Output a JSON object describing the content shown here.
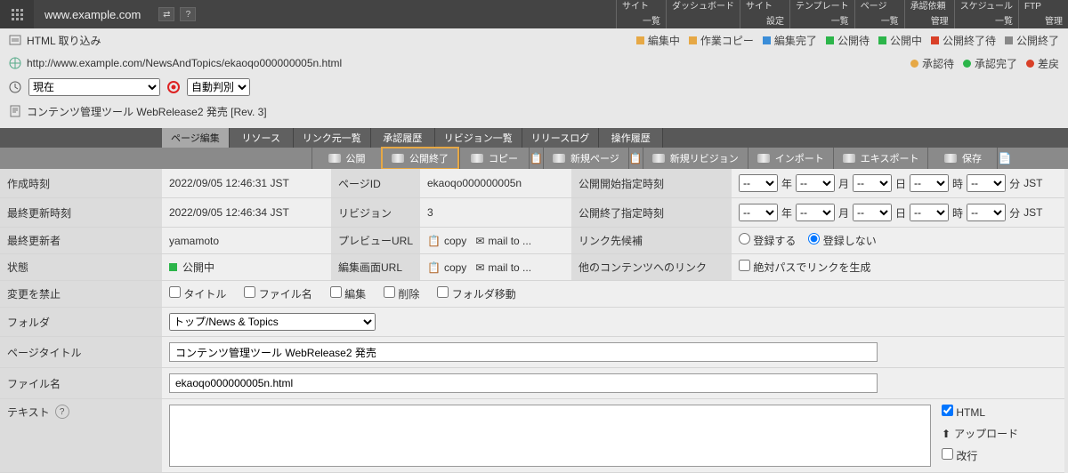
{
  "header": {
    "site_name": "www.example.com",
    "nav": [
      {
        "label": "サイト",
        "sub": "一覧"
      },
      {
        "label": "ダッシュボード",
        "sub": ""
      },
      {
        "label": "サイト",
        "sub": "設定"
      },
      {
        "label": "テンプレート",
        "sub": "一覧"
      },
      {
        "label": "ページ",
        "sub": "一覧"
      },
      {
        "label": "承認依頼",
        "sub": "管理"
      },
      {
        "label": "スケジュール",
        "sub": "一覧"
      },
      {
        "label": "FTP",
        "sub": "管理"
      }
    ]
  },
  "import_row": {
    "label": "HTML 取り込み",
    "status_legend": [
      {
        "label": "編集中",
        "color": "#e6a845",
        "shape": "sq"
      },
      {
        "label": "作業コピー",
        "color": "#e6a845",
        "shape": "sq"
      },
      {
        "label": "編集完了",
        "color": "#3a8dd8",
        "shape": "sq"
      },
      {
        "label": "公開待",
        "color": "#2cb54a",
        "shape": "sq"
      },
      {
        "label": "公開中",
        "color": "#2cb54a",
        "shape": "sq"
      },
      {
        "label": "公開終了待",
        "color": "#d94028",
        "shape": "sq"
      },
      {
        "label": "公開終了",
        "color": "#888",
        "shape": "sq"
      }
    ]
  },
  "url_row": {
    "url": "http://www.example.com/NewsAndTopics/ekaoqo000000005n.html",
    "approval_legend": [
      {
        "label": "承認待",
        "color": "#e6a845",
        "shape": "circ"
      },
      {
        "label": "承認完了",
        "color": "#2cb54a",
        "shape": "circ"
      },
      {
        "label": "差戻",
        "color": "#d94028",
        "shape": "circ"
      }
    ]
  },
  "history_row": {
    "time_select_value": "現在",
    "encoding_select_value": "自動判別"
  },
  "title_row": {
    "page_title_display": "コンテンツ管理ツール WebRelease2 発売 [Rev. 3]"
  },
  "tabs": [
    "ページ編集",
    "リソース",
    "リンク元一覧",
    "承認履歴",
    "リビジョン一覧",
    "リリースログ",
    "操作履歴"
  ],
  "active_tab": "ページ編集",
  "toolbar": {
    "publish": "公開",
    "unpublish": "公開終了",
    "copy": "コピー",
    "new_page": "新規ページ",
    "new_revision": "新規リビジョン",
    "import": "インポート",
    "export": "エキスポート",
    "save": "保存"
  },
  "details": {
    "created_label": "作成時刻",
    "created_value": "2022/09/05 12:46:31 JST",
    "updated_label": "最終更新時刻",
    "updated_value": "2022/09/05 12:46:34 JST",
    "updater_label": "最終更新者",
    "updater_value": "yamamoto",
    "state_label": "状態",
    "state_value": "公開中",
    "page_id_label": "ページID",
    "page_id_value": "ekaoqo000000005n",
    "revision_label": "リビジョン",
    "revision_value": "3",
    "preview_url_label": "プレビューURL",
    "edit_url_label": "編集画面URL",
    "copy_action": "copy",
    "mailto_action": "mail to ...",
    "pub_start_label": "公開開始指定時刻",
    "pub_end_label": "公開終了指定時刻",
    "date_units": {
      "year": "年",
      "month": "月",
      "day": "日",
      "hour": "時",
      "minute": "分",
      "tz": "JST",
      "dash": "--"
    },
    "link_candidate_label": "リンク先候補",
    "link_candidate_yes": "登録する",
    "link_candidate_no": "登録しない",
    "other_link_label": "他のコンテンツへのリンク",
    "abs_path_label": "絶対パスでリンクを生成",
    "lock_label": "変更を禁止",
    "lock_options": [
      "タイトル",
      "ファイル名",
      "編集",
      "削除",
      "フォルダ移動"
    ],
    "folder_label": "フォルダ",
    "folder_value": "トップ/News & Topics",
    "page_title_label": "ページタイトル",
    "page_title_value": "コンテンツ管理ツール WebRelease2 発売",
    "filename_label": "ファイル名",
    "filename_value": "ekaoqo000000005n.html",
    "text_label": "テキスト",
    "text_value": "",
    "html_checkbox": "HTML",
    "upload_label": "アップロード",
    "linebreak_label": "改行"
  }
}
